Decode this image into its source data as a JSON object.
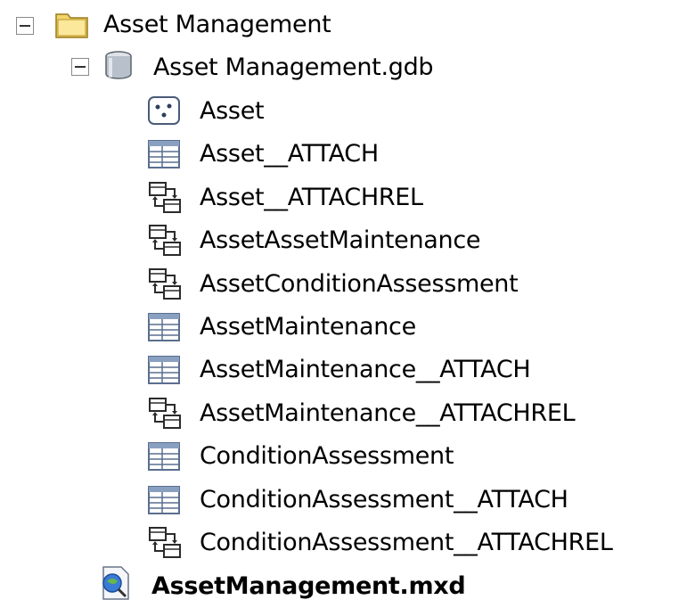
{
  "root": {
    "label": "Asset Management",
    "icon": "folder-icon",
    "expanded": true
  },
  "gdb": {
    "label": "Asset Management.gdb",
    "icon": "database-icon",
    "expanded": true,
    "items": [
      {
        "label": "Asset",
        "icon": "point-feature-class-icon"
      },
      {
        "label": "Asset__ATTACH",
        "icon": "table-icon"
      },
      {
        "label": "Asset__ATTACHREL",
        "icon": "relationship-class-icon"
      },
      {
        "label": "AssetAssetMaintenance",
        "icon": "relationship-class-icon"
      },
      {
        "label": "AssetConditionAssessment",
        "icon": "relationship-class-icon"
      },
      {
        "label": "AssetMaintenance",
        "icon": "table-icon"
      },
      {
        "label": "AssetMaintenance__ATTACH",
        "icon": "table-icon"
      },
      {
        "label": "AssetMaintenance__ATTACHREL",
        "icon": "relationship-class-icon"
      },
      {
        "label": "ConditionAssessment",
        "icon": "table-icon"
      },
      {
        "label": "ConditionAssessment__ATTACH",
        "icon": "table-icon"
      },
      {
        "label": "ConditionAssessment__ATTACHREL",
        "icon": "relationship-class-icon"
      }
    ]
  },
  "mxd": {
    "label": "AssetManagement.mxd",
    "icon": "map-document-icon"
  },
  "colors": {
    "folder": "#f3d36b",
    "table_border": "#5a6f8f",
    "relationship": "#2b2b2b"
  }
}
